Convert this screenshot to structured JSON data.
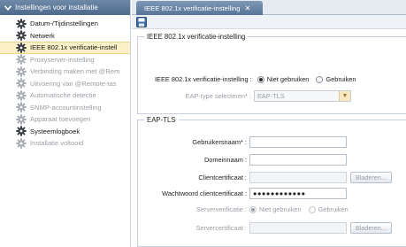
{
  "sidebar": {
    "header": "Instellingen voor installatie",
    "items": [
      {
        "label": "Datum-/Tijdinstellingen",
        "state": "normal"
      },
      {
        "label": "Netwerk",
        "state": "normal"
      },
      {
        "label": "IEEE 802.1x verificatie-instell",
        "state": "selected"
      },
      {
        "label": "Proxyserver-instelling",
        "state": "disabled"
      },
      {
        "label": "Verbinding maken met @Rem",
        "state": "disabled"
      },
      {
        "label": "Uitvoering van @Remote-tas",
        "state": "disabled"
      },
      {
        "label": "Automatische detectie",
        "state": "disabled"
      },
      {
        "label": "SNMP-accountinstelling",
        "state": "disabled"
      },
      {
        "label": "Apparaat toevoegen",
        "state": "disabled"
      },
      {
        "label": "Systeemlogboek",
        "state": "normal"
      },
      {
        "label": "Installatie voltooid",
        "state": "disabled"
      }
    ]
  },
  "tab": {
    "label": "IEEE 802.1x verificatie-instelling",
    "close": "✕"
  },
  "ieee": {
    "legend": "IEEE 802.1x verificatie-instelling",
    "setting_label": "IEEE 802.1x verificatie-instelling :",
    "opt_off": "Niet gebruiken",
    "opt_on": "Gebruiken",
    "eap_label": "EAP-type selecteren* :",
    "eap_value": "EAP-TLS"
  },
  "eaptls": {
    "legend": "EAP-TLS",
    "username_label": "Gebruikersnaam* :",
    "username_value": "",
    "domain_label": "Domeinnaam :",
    "domain_value": "",
    "clientcert_label": "Clientcertificaat :",
    "clientcert_value": "",
    "browse1": "Bladeren...",
    "certpass_label": "Wachtwoord clientcertificaat :",
    "certpass_value": "●●●●●●●●●●●●",
    "serververif_label": "Serververificatie :",
    "sv_off": "Niet gebruiken",
    "sv_on": "Gebruiken",
    "servercert_label": "Servercertificaat :",
    "servercert_value": "",
    "browse2": "Bladeren..."
  }
}
